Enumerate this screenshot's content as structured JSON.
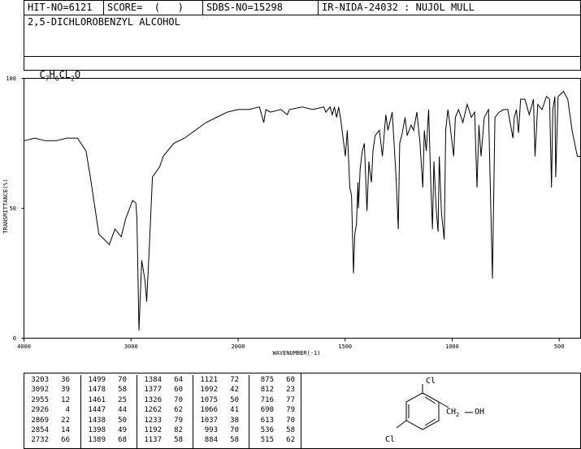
{
  "header": {
    "hit_no": "HIT-NO=6121",
    "score": "SCORE=  (   )",
    "sdbs_no": "SDBS-NO=15298",
    "ir_nida": "IR-NIDA-24032 : NUJOL MULL"
  },
  "compound_name": "2,5-DICHLOROBENZYL ALCOHOL",
  "formula": {
    "c": "C",
    "c_n": "7",
    "h": "H",
    "h_n": "6",
    "cl": "CL",
    "cl_n": "2",
    "o": "O"
  },
  "chart_data": {
    "type": "line",
    "xlabel": "WAVENUMBER(-1)",
    "ylabel": "TRANSMITTANCE(%)",
    "xlim": [
      4000,
      400
    ],
    "ylim": [
      0,
      100
    ],
    "x_ticks": [
      "4000",
      "3000",
      "2000",
      "1500",
      "1000",
      "500"
    ],
    "y_ticks": [
      "100",
      "50",
      "0"
    ],
    "series": [
      {
        "x": [
          4000,
          3900,
          3800,
          3700,
          3600,
          3500,
          3420,
          3380,
          3300,
          3250,
          3203,
          3150,
          3092,
          3050,
          2985,
          2955,
          2945,
          2926,
          2900,
          2869,
          2854,
          2830,
          2800,
          2732,
          2700,
          2600,
          2500,
          2400,
          2300,
          2200,
          2100,
          2000,
          1950,
          1900,
          1880,
          1870,
          1850,
          1800,
          1770,
          1760,
          1700,
          1650,
          1600,
          1590,
          1570,
          1560,
          1550,
          1540,
          1530,
          1520,
          1499,
          1490,
          1478,
          1470,
          1461,
          1455,
          1447,
          1440,
          1438,
          1430,
          1420,
          1410,
          1398,
          1389,
          1384,
          1377,
          1370,
          1360,
          1340,
          1326,
          1310,
          1300,
          1280,
          1262,
          1252,
          1245,
          1233,
          1220,
          1210,
          1192,
          1180,
          1165,
          1150,
          1137,
          1130,
          1121,
          1110,
          1100,
          1092,
          1085,
          1075,
          1066,
          1060,
          1050,
          1037,
          1030,
          1020,
          1010,
          993,
          985,
          970,
          950,
          930,
          910,
          895,
          884,
          875,
          865,
          850,
          830,
          812,
          800,
          780,
          760,
          740,
          716,
          710,
          700,
          690,
          680,
          660,
          640,
          620,
          613,
          600,
          580,
          560,
          545,
          536,
          530,
          520,
          516,
          505,
          480,
          460,
          440,
          415,
          405,
          400
        ],
        "values": [
          76,
          77,
          76,
          76,
          77,
          77,
          72,
          62,
          40,
          38,
          36,
          42,
          39,
          46,
          53,
          52,
          46,
          3,
          30,
          22,
          14,
          34,
          62,
          66,
          70,
          75,
          77,
          80,
          83,
          85,
          87,
          88,
          88,
          89,
          83,
          88,
          87,
          88,
          86,
          88,
          89,
          88,
          89,
          87,
          89,
          86,
          89,
          85,
          89,
          84,
          70,
          80,
          58,
          55,
          25,
          40,
          44,
          60,
          50,
          65,
          72,
          75,
          49,
          68,
          64,
          60,
          72,
          78,
          80,
          70,
          86,
          80,
          87,
          62,
          42,
          75,
          79,
          85,
          78,
          82,
          80,
          87,
          75,
          58,
          80,
          72,
          88,
          60,
          42,
          68,
          50,
          41,
          70,
          48,
          38,
          80,
          88,
          82,
          70,
          85,
          88,
          83,
          90,
          85,
          87,
          58,
          82,
          70,
          85,
          88,
          23,
          85,
          87,
          88,
          88,
          77,
          85,
          88,
          79,
          92,
          92,
          86,
          92,
          70,
          90,
          88,
          93,
          92,
          58,
          88,
          93,
          62,
          93,
          95,
          92,
          80,
          70,
          70,
          70
        ]
      }
    ]
  },
  "peak_table": [
    [
      [
        "3203",
        "36"
      ],
      [
        "3092",
        "39"
      ],
      [
        "2955",
        "12"
      ],
      [
        "2926",
        "4"
      ],
      [
        "2869",
        "22"
      ],
      [
        "2854",
        "14"
      ],
      [
        "2732",
        "66"
      ]
    ],
    [
      [
        "1499",
        "70"
      ],
      [
        "1478",
        "58"
      ],
      [
        "1461",
        "25"
      ],
      [
        "1447",
        "44"
      ],
      [
        "1438",
        "50"
      ],
      [
        "1398",
        "49"
      ],
      [
        "1389",
        "68"
      ]
    ],
    [
      [
        "1384",
        "64"
      ],
      [
        "1377",
        "60"
      ],
      [
        "1326",
        "70"
      ],
      [
        "1262",
        "62"
      ],
      [
        "1233",
        "79"
      ],
      [
        "1192",
        "82"
      ],
      [
        "1137",
        "58"
      ]
    ],
    [
      [
        "1121",
        "72"
      ],
      [
        "1092",
        "42"
      ],
      [
        "1075",
        "50"
      ],
      [
        "1066",
        "41"
      ],
      [
        "1037",
        "38"
      ],
      [
        "993",
        "70"
      ],
      [
        "884",
        "58"
      ]
    ],
    [
      [
        "875",
        "60"
      ],
      [
        "812",
        "23"
      ],
      [
        "716",
        "77"
      ],
      [
        "690",
        "79"
      ],
      [
        "613",
        "70"
      ],
      [
        "536",
        "58"
      ],
      [
        "515",
        "62"
      ]
    ]
  ],
  "structure": {
    "cl_top": "Cl",
    "cl_bottom": "Cl",
    "ch2": "CH",
    "ch2_sub": "2",
    "oh": "OH"
  }
}
